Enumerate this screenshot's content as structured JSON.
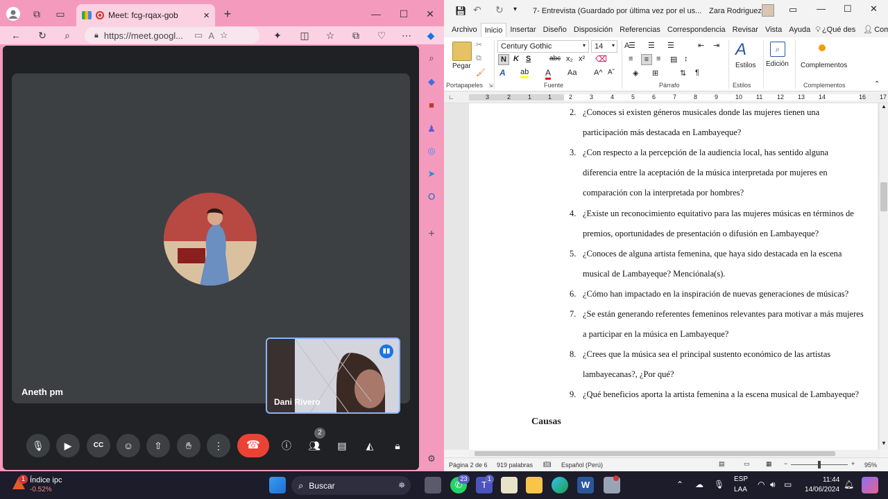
{
  "edge": {
    "tab_title": "Meet: fcg-rqax-gob",
    "address": "https://meet.googl...",
    "new_tab": "+",
    "close_tab": "×"
  },
  "meet": {
    "main_participant": "Aneth pm",
    "self_participant": "Dani Rivero",
    "participants_badge": "2"
  },
  "word": {
    "title": "7- Entrevista (Guardado por última vez por el us...",
    "user": "Zara Rodriguez",
    "tabs": [
      "Archivo",
      "Inicio",
      "Insertar",
      "Diseño",
      "Disposición",
      "Referencias",
      "Correspondencia",
      "Revisar",
      "Vista",
      "Ayuda"
    ],
    "tell_me": "¿Qué des",
    "share": "Compartir",
    "ribbon": {
      "paste": "Pegar",
      "font_name": "Century Gothic",
      "font_size": "14",
      "styles": "Estilos",
      "editing": "Edición",
      "addins": "Complementos",
      "groups": {
        "clipboard": "Portapapeles",
        "font": "Fuente",
        "paragraph": "Párrafo",
        "styles": "Estilos",
        "addins": "Complementos"
      }
    },
    "ruler_numbers": [
      "3",
      "2",
      "1",
      "1",
      "2",
      "3",
      "4",
      "5",
      "6",
      "7",
      "8",
      "9",
      "10",
      "11",
      "12",
      "13",
      "14",
      "16",
      "17"
    ],
    "questions": [
      {
        "n": "2.",
        "lines": [
          "¿Conoces si existen géneros musicales donde las mujeres tienen una",
          "participación más destacada en Lambayeque?"
        ]
      },
      {
        "n": "3.",
        "lines": [
          "¿Con respecto a la percepción de la audiencia local, has sentido alguna",
          "diferencia entre la aceptación de la música interpretada por mujeres en",
          "comparación con la interpretada por hombres?"
        ]
      },
      {
        "n": "4.",
        "lines": [
          "¿Existe un reconocimiento equitativo para las mujeres músicas en términos de",
          "premios, oportunidades de presentación o difusión en Lambayeque?"
        ]
      },
      {
        "n": "5.",
        "lines": [
          "¿Conoces de alguna artista femenina, que haya sido destacada en la escena",
          "musical de Lambayeque? Menciónala(s)."
        ]
      },
      {
        "n": "6.",
        "lines": [
          "¿Cómo han impactado en la inspiración de nuevas generaciones de músicas?"
        ]
      },
      {
        "n": "7.",
        "lines": [
          "¿Se están generando referentes femeninos relevantes para motivar a más mujeres",
          "a participar en la música en Lambayeque?"
        ]
      },
      {
        "n": "8.",
        "lines": [
          "¿Crees que la música sea el principal sustento económico de las artistas",
          "lambayecanas?, ¿Por qué?"
        ]
      },
      {
        "n": "9.",
        "lines": [
          "¿Qué beneficios aporta la artista femenina a la escena musical de Lambayeque?"
        ]
      }
    ],
    "heading": "Causas",
    "status": {
      "page": "Página 2 de 6",
      "words": "919 palabras",
      "lang": "Español (Perú)",
      "zoom": "95%"
    }
  },
  "taskbar": {
    "widget_title": "Índice ipc",
    "widget_value": "-0.52%",
    "widget_badge": "1",
    "search": "Buscar",
    "whatsapp_badge": "23",
    "teams_badge": "1",
    "lang_line1": "ESP",
    "lang_line2": "LAA",
    "time": "11:44",
    "date": "14/06/2024"
  }
}
